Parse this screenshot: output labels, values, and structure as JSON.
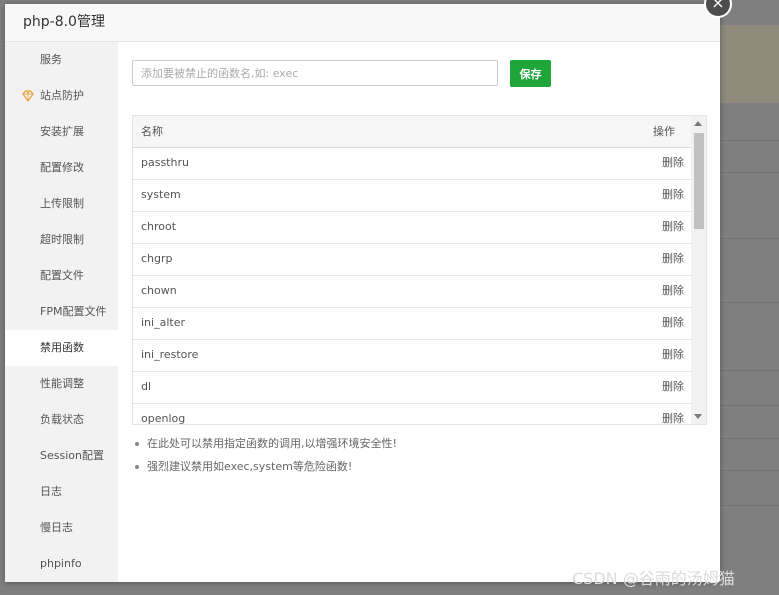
{
  "window": {
    "title": "php-8.0管理"
  },
  "sidebar": {
    "items": [
      {
        "label": "服务"
      },
      {
        "label": "站点防护"
      },
      {
        "label": "安装扩展"
      },
      {
        "label": "配置修改"
      },
      {
        "label": "上传限制"
      },
      {
        "label": "超时限制"
      },
      {
        "label": "配置文件"
      },
      {
        "label": "FPM配置文件"
      },
      {
        "label": "禁用函数"
      },
      {
        "label": "性能调整"
      },
      {
        "label": "负载状态"
      },
      {
        "label": "Session配置"
      },
      {
        "label": "日志"
      },
      {
        "label": "慢日志"
      },
      {
        "label": "phpinfo"
      }
    ],
    "active": "禁用函数"
  },
  "form": {
    "input_placeholder": "添加要被禁止的函数名,如: exec",
    "input_value": "",
    "save_label": "保存"
  },
  "table": {
    "headers": {
      "name": "名称",
      "action": "操作"
    },
    "rows": [
      {
        "name": "passthru",
        "action": "删除"
      },
      {
        "name": "system",
        "action": "删除"
      },
      {
        "name": "chroot",
        "action": "删除"
      },
      {
        "name": "chgrp",
        "action": "删除"
      },
      {
        "name": "chown",
        "action": "删除"
      },
      {
        "name": "ini_alter",
        "action": "删除"
      },
      {
        "name": "ini_restore",
        "action": "删除"
      },
      {
        "name": "dl",
        "action": "删除"
      },
      {
        "name": "openlog",
        "action": "删除"
      },
      {
        "name": "",
        "action": ""
      }
    ]
  },
  "tips": [
    "在此处可以禁用指定函数的调用,以增强环境安全性!",
    "强烈建议禁用如exec,system等危险函数!"
  ],
  "watermark": "CSDN @谷雨的汤姆猫",
  "colors": {
    "accent": "#20a53a",
    "sidebar_bg": "#f2f2f2",
    "overlay": "#7f7f7f"
  },
  "icons": {
    "close": "close-icon",
    "site_protect": "gem-icon"
  }
}
